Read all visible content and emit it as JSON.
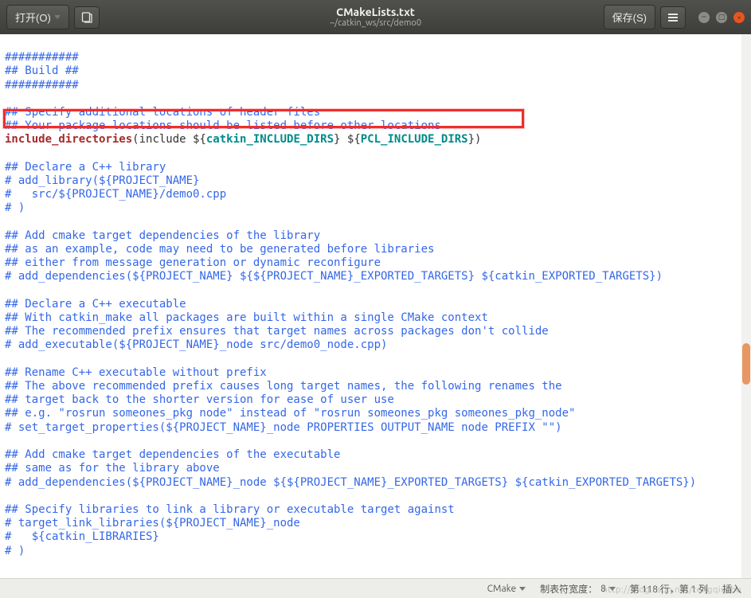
{
  "titlebar": {
    "open_label": "打开(O)",
    "save_label": "保存(S)",
    "title": "CMakeLists.txt",
    "subtitle": "~/catkin_ws/src/demo0"
  },
  "code": {
    "l1": "###########",
    "l2": "## Build ##",
    "l3": "###########",
    "l4": "",
    "l5": "## Specify additional locations of header files",
    "l6": "## Your package locations should be listed before other locations",
    "l7a": "include_directories",
    "l7b": "(include ${",
    "l7c": "catkin_INCLUDE_DIRS",
    "l7d": "} ${",
    "l7e": "PCL_INCLUDE_DIRS",
    "l7f": "})",
    "l8": "",
    "l9": "## Declare a C++ library",
    "l10": "# add_library(${PROJECT_NAME}",
    "l11": "#   src/${PROJECT_NAME}/demo0.cpp",
    "l12": "# )",
    "l13": "",
    "l14": "## Add cmake target dependencies of the library",
    "l15": "## as an example, code may need to be generated before libraries",
    "l16": "## either from message generation or dynamic reconfigure",
    "l17": "# add_dependencies(${PROJECT_NAME} ${${PROJECT_NAME}_EXPORTED_TARGETS} ${catkin_EXPORTED_TARGETS})",
    "l18": "",
    "l19": "## Declare a C++ executable",
    "l20": "## With catkin_make all packages are built within a single CMake context",
    "l21": "## The recommended prefix ensures that target names across packages don't collide",
    "l22": "# add_executable(${PROJECT_NAME}_node src/demo0_node.cpp)",
    "l23": "",
    "l24": "## Rename C++ executable without prefix",
    "l25": "## The above recommended prefix causes long target names, the following renames the",
    "l26": "## target back to the shorter version for ease of user use",
    "l27": "## e.g. \"rosrun someones_pkg node\" instead of \"rosrun someones_pkg someones_pkg_node\"",
    "l28": "# set_target_properties(${PROJECT_NAME}_node PROPERTIES OUTPUT_NAME node PREFIX \"\")",
    "l29": "",
    "l30": "## Add cmake target dependencies of the executable",
    "l31": "## same as for the library above",
    "l32": "# add_dependencies(${PROJECT_NAME}_node ${${PROJECT_NAME}_EXPORTED_TARGETS} ${catkin_EXPORTED_TARGETS})",
    "l33": "",
    "l34": "## Specify libraries to link a library or executable target against",
    "l35": "# target_link_libraries(${PROJECT_NAME}_node",
    "l36": "#   ${catkin_LIBRARIES}",
    "l37": "# )"
  },
  "statusbar": {
    "language": "CMake",
    "tabwidth_label": "制表符宽度：",
    "tabwidth_value": "8",
    "position": "第 118 行，第 1 列",
    "mode": "插入"
  },
  "watermark": "http://blog.csdn.net/tengqiuzhu"
}
